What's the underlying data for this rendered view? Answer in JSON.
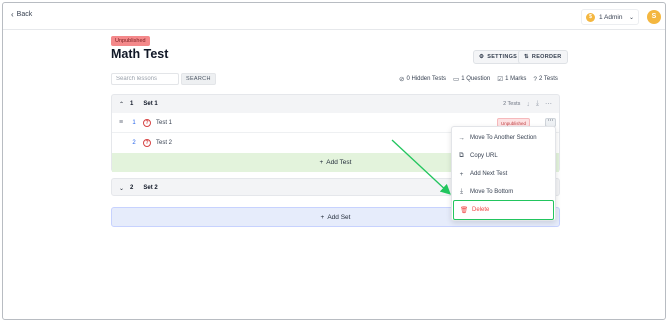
{
  "topbar": {
    "back_label": "Back",
    "account_label": "1 Admin",
    "avatar_initial": "S",
    "coin_glyph": "$"
  },
  "header": {
    "status_badge": "Unpublished",
    "title": "Math Test",
    "settings_label": "SETTINGS",
    "reorder_label": "REORDER"
  },
  "search": {
    "placeholder": "Search lessons",
    "button_label": "SEARCH"
  },
  "stats": {
    "hidden_tests": "0 Hidden Tests",
    "questions": "1 Question",
    "marks": "1 Marks",
    "tests": "2 Tests"
  },
  "sets": [
    {
      "number": "1",
      "name": "Set 1",
      "tests_count": "2 Tests",
      "tests": [
        {
          "number": "1",
          "name": "Test 1",
          "status": "Unpublished"
        },
        {
          "number": "2",
          "name": "Test 2"
        }
      ],
      "add_test_label": "Add Test"
    },
    {
      "number": "2",
      "name": "Set 2"
    }
  ],
  "add_set_label": "Add Set",
  "menu": {
    "items": [
      {
        "label": "Move To Another Section",
        "icon": "arrow-right-icon"
      },
      {
        "label": "Copy URL",
        "icon": "copy-icon"
      },
      {
        "label": "Add Next Test",
        "icon": "plus-icon"
      },
      {
        "label": "Move To Bottom",
        "icon": "arrow-down-icon"
      },
      {
        "label": "Delete",
        "icon": "trash-icon"
      }
    ]
  },
  "colors": {
    "unpublished_badge": "#f4898b",
    "add_test_bg": "#e3f3dc",
    "add_set_bg": "#e6ecfb",
    "highlight": "#22c55e",
    "delete_text": "#ef4444"
  }
}
